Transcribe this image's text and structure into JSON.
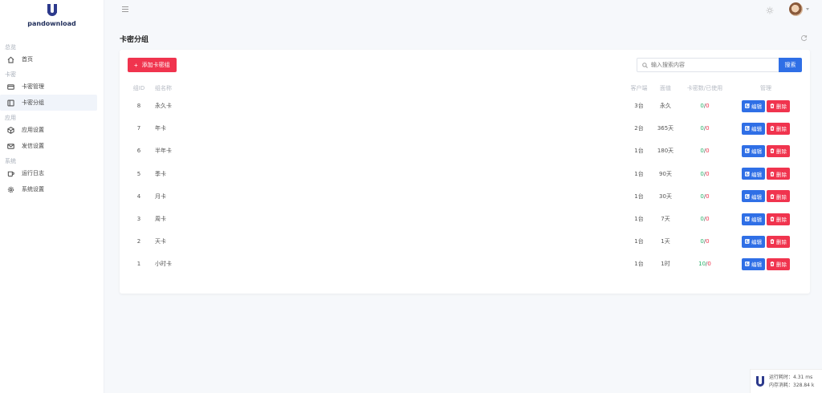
{
  "app": {
    "name": "pandownload"
  },
  "sidebar": {
    "groups": [
      {
        "title": "总览",
        "items": [
          {
            "label": "首页",
            "icon": "home-icon"
          }
        ]
      },
      {
        "title": "卡密",
        "items": [
          {
            "label": "卡密管理",
            "icon": "card-icon"
          },
          {
            "label": "卡密分组",
            "icon": "group-icon",
            "active": true
          }
        ]
      },
      {
        "title": "应用",
        "items": [
          {
            "label": "应用设置",
            "icon": "box-icon"
          },
          {
            "label": "发信设置",
            "icon": "mail-icon"
          }
        ]
      },
      {
        "title": "系统",
        "items": [
          {
            "label": "运行日志",
            "icon": "log-icon"
          },
          {
            "label": "系统设置",
            "icon": "gear-icon"
          }
        ]
      }
    ]
  },
  "page": {
    "title": "卡密分组"
  },
  "toolbar": {
    "add_label": "添加卡密组",
    "search_placeholder": "输入搜索内容",
    "search_label": "搜索"
  },
  "table": {
    "headers": {
      "id": "组ID",
      "name": "组名称",
      "devices": "客户端",
      "face": "面值",
      "count": "卡密数/已使用",
      "manage": "管理"
    },
    "edit_label": "编辑",
    "delete_label": "删除",
    "rows": [
      {
        "id": "8",
        "name": "永久卡",
        "devices": "3台",
        "face": "永久",
        "total": "0",
        "used": "0"
      },
      {
        "id": "7",
        "name": "年卡",
        "devices": "2台",
        "face": "365天",
        "total": "0",
        "used": "0"
      },
      {
        "id": "6",
        "name": "半年卡",
        "devices": "1台",
        "face": "180天",
        "total": "0",
        "used": "0"
      },
      {
        "id": "5",
        "name": "季卡",
        "devices": "1台",
        "face": "90天",
        "total": "0",
        "used": "0"
      },
      {
        "id": "4",
        "name": "月卡",
        "devices": "1台",
        "face": "30天",
        "total": "0",
        "used": "0"
      },
      {
        "id": "3",
        "name": "周卡",
        "devices": "1台",
        "face": "7天",
        "total": "0",
        "used": "0"
      },
      {
        "id": "2",
        "name": "天卡",
        "devices": "1台",
        "face": "1天",
        "total": "0",
        "used": "0"
      },
      {
        "id": "1",
        "name": "小时卡",
        "devices": "1台",
        "face": "1时",
        "total": "10",
        "used": "0"
      }
    ]
  },
  "perf": {
    "runtime": "运行耗时：4.31 ms",
    "memory": "内存消耗：328.84 k"
  },
  "colors": {
    "primary": "#2f6fe6",
    "danger": "#f0344e",
    "success": "#28b26a",
    "brand": "#2d3a8c"
  }
}
